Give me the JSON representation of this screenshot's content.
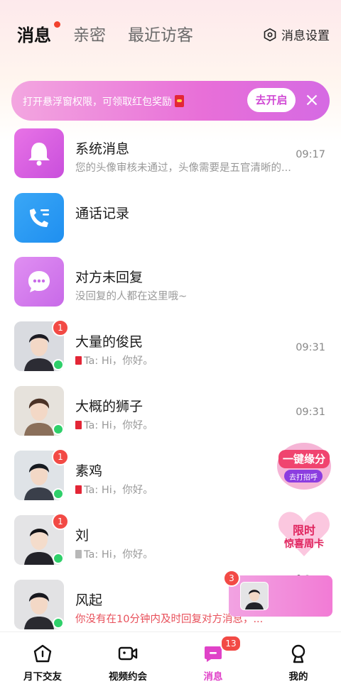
{
  "header": {
    "tabs": [
      {
        "label": "消息",
        "active": true
      },
      {
        "label": "亲密",
        "active": false
      },
      {
        "label": "最近访客",
        "active": false
      }
    ],
    "settings_label": "消息设置"
  },
  "banner": {
    "text": "打开悬浮窗权限，可领取红包奖励",
    "button_label": "去开启"
  },
  "rows": [
    {
      "name": "系统消息",
      "subtitle": "您的头像审核未通过，头像需要是五官清晰的...",
      "time": "09:17",
      "icon": "bell-icon"
    },
    {
      "name": "通话记录",
      "icon": "phone-list-icon"
    },
    {
      "name": "对方未回复",
      "subtitle": "没回复的人都在这里哦~",
      "icon": "chat-bubble-icon"
    },
    {
      "name": "大量的俊民",
      "prefix": "Ta:",
      "subtitle": "Hi，你好。",
      "time": "09:31",
      "badge": "1"
    },
    {
      "name": "大概的狮子",
      "prefix": "Ta:",
      "subtitle": "Hi，你好。",
      "time": "09:31"
    },
    {
      "name": "素鸡",
      "prefix": "Ta:",
      "subtitle": "Hi，你好。",
      "badge": "1"
    },
    {
      "name": "刘",
      "prefix": "Ta:",
      "subtitle": "Hi，你好。",
      "badge": "1"
    },
    {
      "name": "风起",
      "subtitle": "你没有在10分钟内及时回复对方消息，..."
    }
  ],
  "floating": {
    "promo1_title": "一键缘分",
    "promo1_sub": "去打招呼",
    "promo2_line1": "限时",
    "promo2_line2": "惊喜周卡",
    "call_badge": "3"
  },
  "bottom_nav": [
    {
      "label": "月下交友",
      "icon": "home-icon"
    },
    {
      "label": "视频约会",
      "icon": "video-icon"
    },
    {
      "label": "消息",
      "icon": "message-icon",
      "badge": "13",
      "active": true
    },
    {
      "label": "我的",
      "icon": "profile-icon"
    }
  ],
  "colors": {
    "accent": "#e042c8",
    "badge": "#f24a45",
    "online": "#2fd06a",
    "warn": "#e8505b"
  }
}
